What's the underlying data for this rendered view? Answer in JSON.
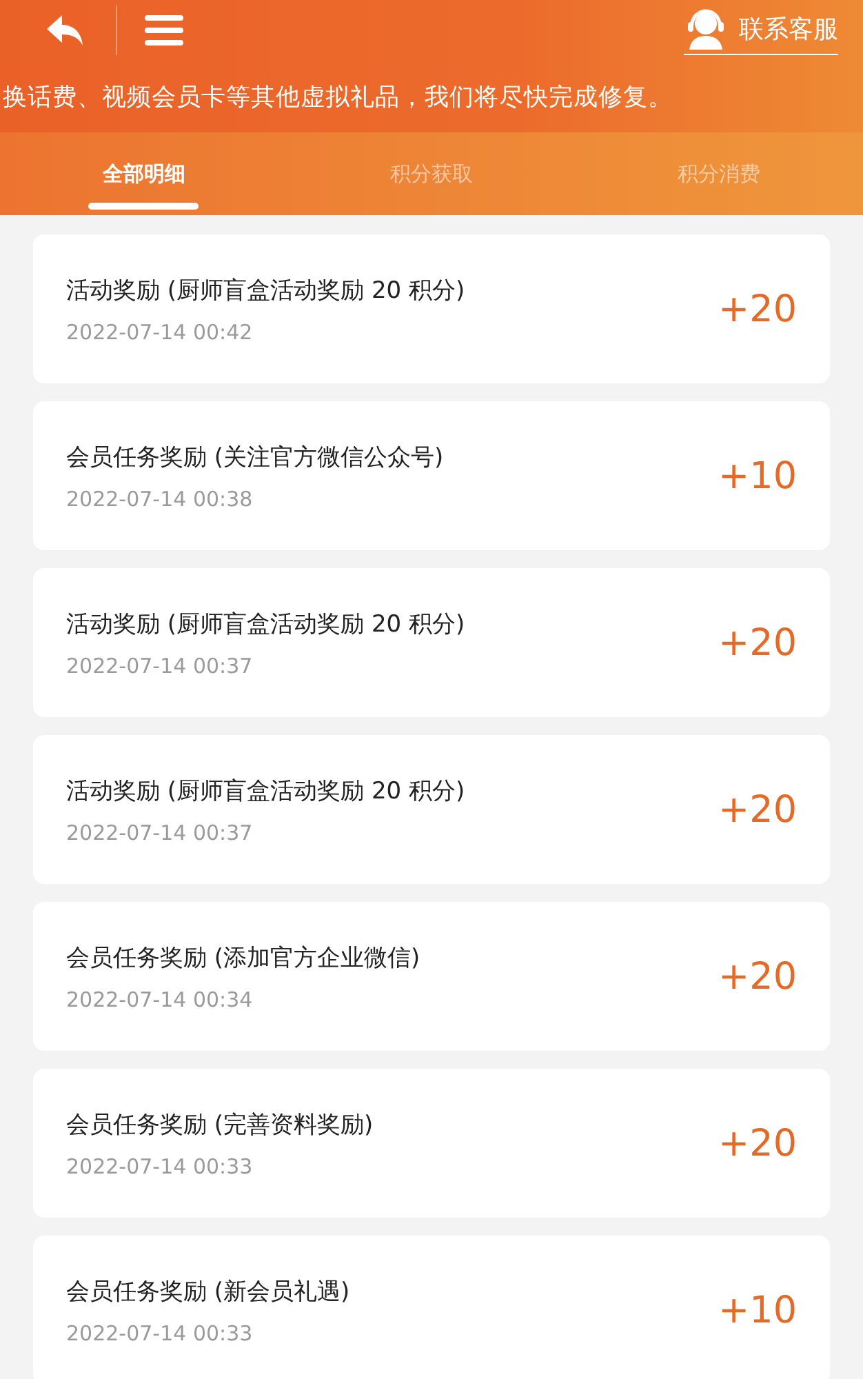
{
  "header": {
    "contact_label": "联系客服"
  },
  "notice": "换话费、视频会员卡等其他虚拟礼品，我们将尽快完成修复。",
  "tabs": [
    {
      "label": "全部明细",
      "selected": true
    },
    {
      "label": "积分获取",
      "selected": false
    },
    {
      "label": "积分消费",
      "selected": false
    }
  ],
  "records": [
    {
      "title": "活动奖励 (厨师盲盒活动奖励 20 积分)",
      "time": "2022-07-14 00:42",
      "points": "+20"
    },
    {
      "title": "会员任务奖励 (关注官方微信公众号)",
      "time": "2022-07-14 00:38",
      "points": "+10"
    },
    {
      "title": "活动奖励 (厨师盲盒活动奖励 20 积分)",
      "time": "2022-07-14 00:37",
      "points": "+20"
    },
    {
      "title": "活动奖励 (厨师盲盒活动奖励 20 积分)",
      "time": "2022-07-14 00:37",
      "points": "+20"
    },
    {
      "title": "会员任务奖励 (添加官方企业微信)",
      "time": "2022-07-14 00:34",
      "points": "+20"
    },
    {
      "title": "会员任务奖励 (完善资料奖励)",
      "time": "2022-07-14 00:33",
      "points": "+20"
    },
    {
      "title": "会员任务奖励 (新会员礼遇)",
      "time": "2022-07-14 00:33",
      "points": "+10"
    }
  ]
}
